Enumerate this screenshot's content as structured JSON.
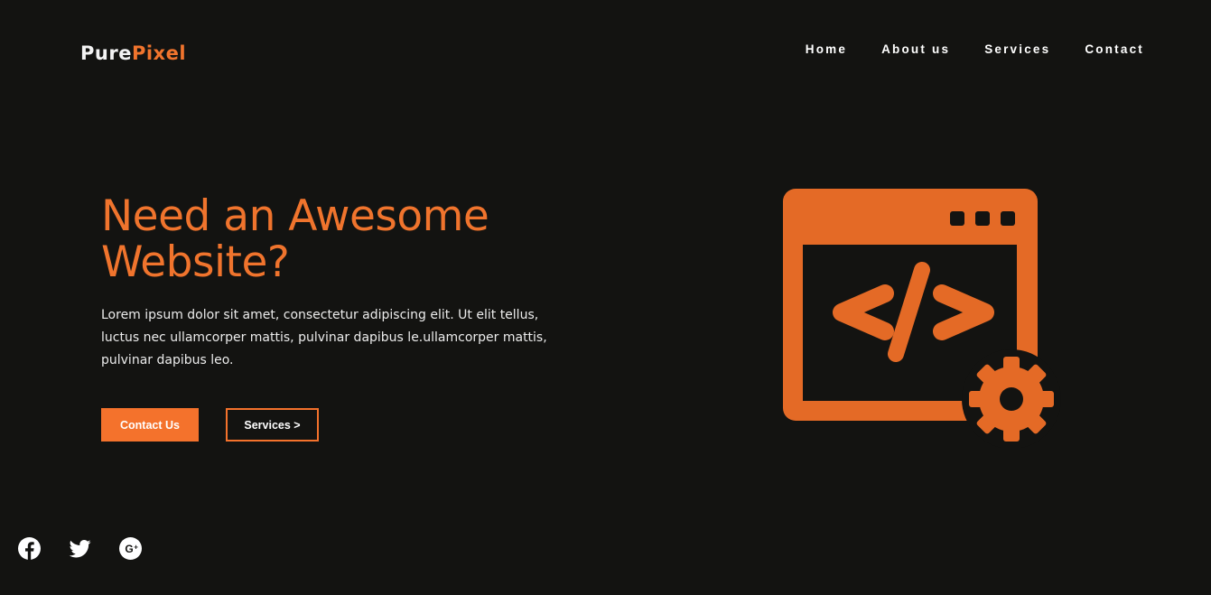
{
  "brand": {
    "logo_part1": "Pure",
    "logo_part2": "Pixel",
    "accent_color": "#f0742d",
    "background_color": "#131311"
  },
  "nav": {
    "items": [
      {
        "label": "Home"
      },
      {
        "label": "About us"
      },
      {
        "label": "Services"
      },
      {
        "label": "Contact"
      }
    ]
  },
  "hero": {
    "title": "Need an Awesome Website?",
    "description": "Lorem ipsum dolor sit amet, consectetur adipiscing elit. Ut elit tellus, luctus nec ullamcorper mattis, pulvinar dapibus le.ullamcorper mattis, pulvinar dapibus leo.",
    "primary_button": "Contact Us",
    "secondary_button": "Services >",
    "illustration_icon": "code-window-gear-icon"
  },
  "social": {
    "icons": [
      "facebook-icon",
      "twitter-icon",
      "google-plus-icon"
    ]
  }
}
